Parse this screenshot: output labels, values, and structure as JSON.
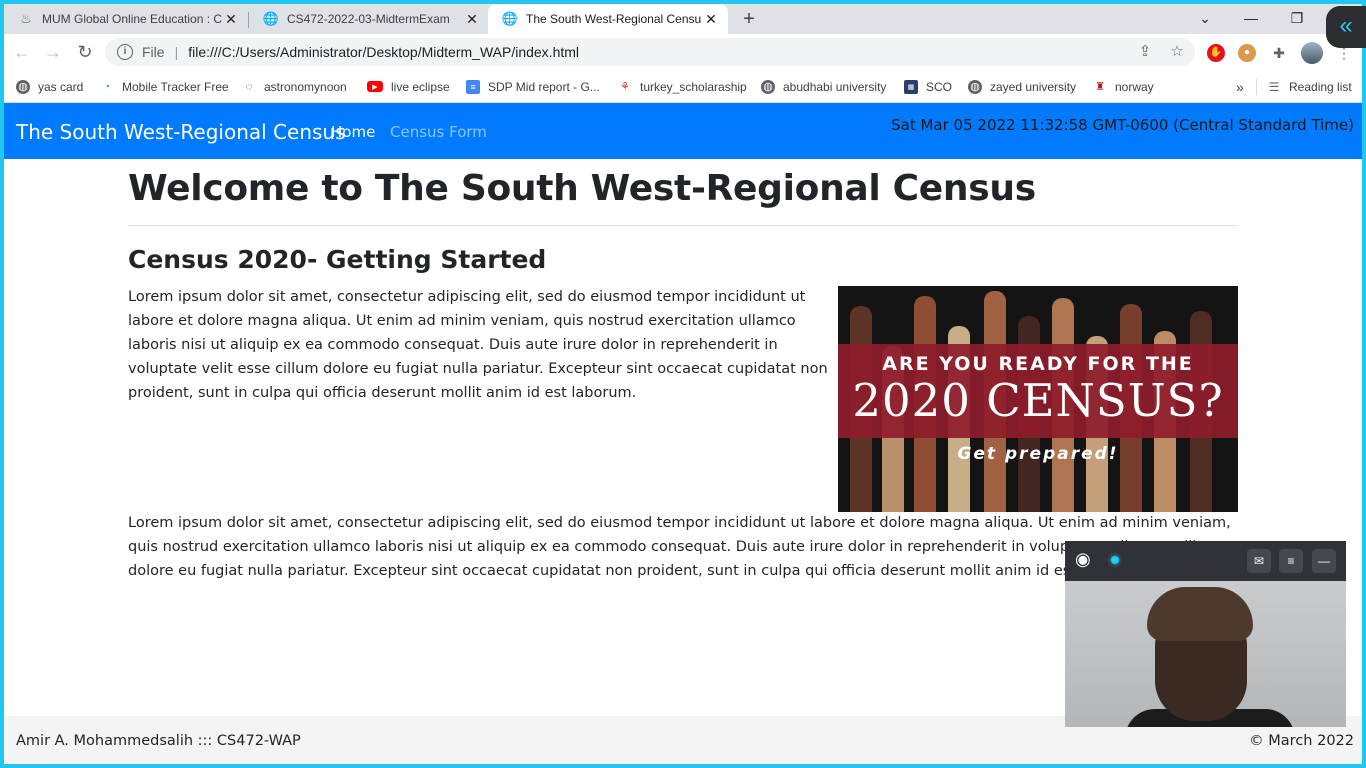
{
  "browser": {
    "tabs": [
      {
        "title": "MUM Global Online Education : C",
        "icon": "moodle-icon"
      },
      {
        "title": "CS472-2022-03-MidtermExam",
        "icon": "globe-icon"
      },
      {
        "title": "The South West-Regional Census",
        "icon": "globe-icon",
        "active": true
      }
    ],
    "url_scheme": "File",
    "url": "file:///C:/Users/Administrator/Desktop/Midterm_WAP/index.html",
    "bookmarks": [
      "yas card",
      "Mobile Tracker Free",
      "astronomynoon",
      "live eclipse",
      "SDP Mid report - G...",
      "turkey_scholaraship",
      "abudhabi university",
      "SCO",
      "zayed university",
      "norway"
    ],
    "reading_list": "Reading list",
    "more_bookmarks": "»"
  },
  "site": {
    "brand": "The South West-Regional Census",
    "nav": {
      "home": "Home",
      "census_form": "Census Form"
    },
    "clock": "Sat Mar 05 2022 11:32:58 GMT-0600 (Central Standard Time)",
    "welcome": "Welcome to The South West-Regional Census",
    "subheading": "Census 2020- Getting Started",
    "paragraph1": "Lorem ipsum dolor sit amet, consectetur adipiscing elit, sed do eiusmod tempor incididunt ut labore et dolore magna aliqua. Ut enim ad minim veniam, quis nostrud exercitation ullamco laboris nisi ut aliquip ex ea commodo consequat. Duis aute irure dolor in reprehenderit in voluptate velit esse cillum dolore eu fugiat nulla pariatur. Excepteur sint occaecat cupidatat non proident, sunt in culpa qui officia deserunt mollit anim id est laborum.",
    "paragraph2": "Lorem ipsum dolor sit amet, consectetur adipiscing elit, sed do eiusmod tempor incididunt ut labore et dolore magna aliqua. Ut enim ad minim veniam, quis nostrud exercitation ullamco laboris nisi ut aliquip ex ea commodo consequat. Duis aute irure dolor in reprehenderit in voluptate velit esse cillum dolore eu fugiat nulla pariatur. Excepteur sint occaecat cupidatat non proident, sunt in culpa qui officia deserunt mollit anim id est laborum.",
    "banner": {
      "line1": "ARE YOU READY FOR THE",
      "line2": "2020 CENSUS?",
      "line3": "Get prepared!"
    },
    "footer_left": "Amir A. Mohammedsalih ::: CS472-WAP",
    "footer_right": "© March 2022"
  },
  "colors": {
    "navbar": "#007bff",
    "banner_red": "#8e1c2a",
    "frame": "#22c7f0"
  }
}
